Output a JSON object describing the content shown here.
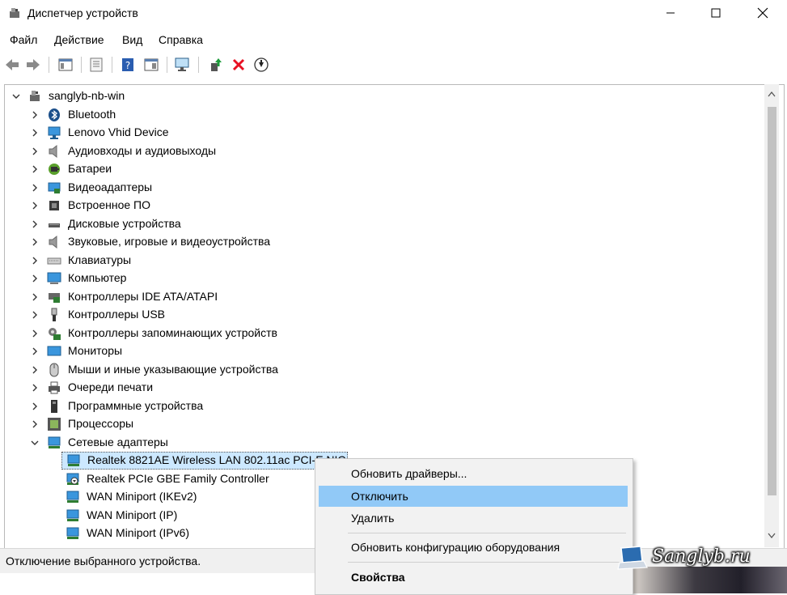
{
  "window": {
    "title": "Диспетчер устройств"
  },
  "menu": [
    "Файл",
    "Действие",
    "Вид",
    "Справка"
  ],
  "tree": {
    "root": "sanglyb-nb-win",
    "categories": [
      {
        "label": "Bluetooth",
        "icon": "bluetooth-icon"
      },
      {
        "label": "Lenovo Vhid Device",
        "icon": "monitor-network-icon"
      },
      {
        "label": "Аудиовходы и аудиовыходы",
        "icon": "speaker-icon"
      },
      {
        "label": "Батареи",
        "icon": "battery-icon"
      },
      {
        "label": "Видеоадаптеры",
        "icon": "display-adapter-icon"
      },
      {
        "label": "Встроенное ПО",
        "icon": "firmware-icon"
      },
      {
        "label": "Дисковые устройства",
        "icon": "disk-drive-icon"
      },
      {
        "label": "Звуковые, игровые и видеоустройства",
        "icon": "speaker-icon"
      },
      {
        "label": "Клавиатуры",
        "icon": "keyboard-icon"
      },
      {
        "label": "Компьютер",
        "icon": "computer-icon"
      },
      {
        "label": "Контроллеры IDE ATA/ATAPI",
        "icon": "ide-controller-icon"
      },
      {
        "label": "Контроллеры USB",
        "icon": "usb-icon"
      },
      {
        "label": "Контроллеры запоминающих устройств",
        "icon": "storage-controller-icon"
      },
      {
        "label": "Мониторы",
        "icon": "monitor-icon"
      },
      {
        "label": "Мыши и иные указывающие устройства",
        "icon": "mouse-icon"
      },
      {
        "label": "Очереди печати",
        "icon": "printer-icon"
      },
      {
        "label": "Программные устройства",
        "icon": "software-device-icon"
      },
      {
        "label": "Процессоры",
        "icon": "processor-icon"
      },
      {
        "label": "Сетевые адаптеры",
        "icon": "network-adapter-icon"
      }
    ],
    "network_children": [
      "Realtek 8821AE Wireless LAN 802.11ac PCI-E NIC",
      "Realtek PCIe GBE Family Controller",
      "WAN Miniport (IKEv2)",
      "WAN Miniport (IP)",
      "WAN Miniport (IPv6)"
    ]
  },
  "context_menu": {
    "items": [
      "Обновить драйверы...",
      "Отключить",
      "Удалить",
      "Обновить конфигурацию оборудования",
      "Свойства"
    ]
  },
  "status": {
    "text": "Отключение выбранного устройства."
  },
  "watermark": {
    "text": "Sanglyb.ru"
  },
  "colors": {
    "highlight": "#91c9f7",
    "network_icon": "#3a96dd",
    "delete_red": "#e81123"
  }
}
